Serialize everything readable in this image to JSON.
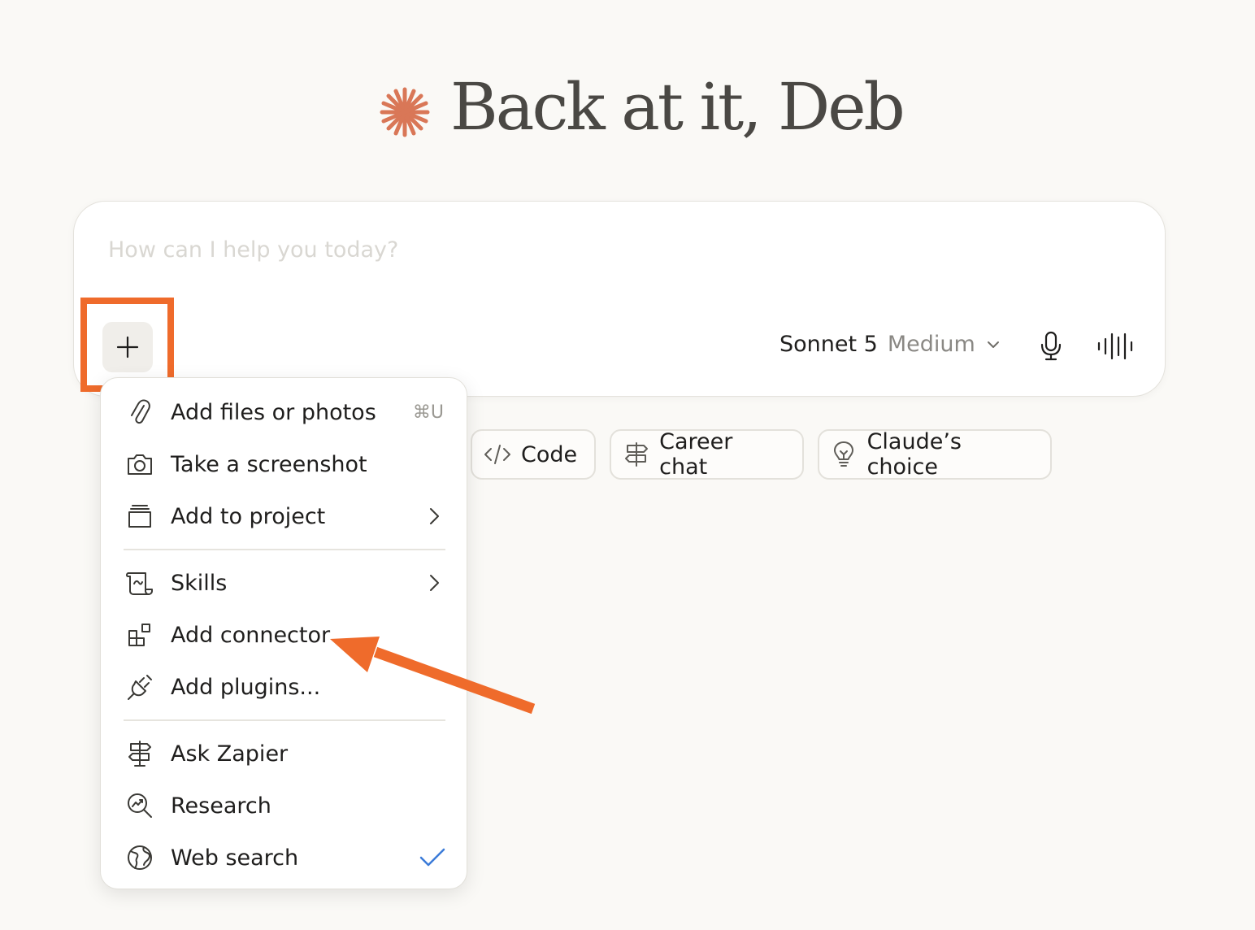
{
  "greeting": {
    "text": "Back at it, Deb"
  },
  "composer": {
    "placeholder": "How can I help you today?",
    "model": {
      "name": "Sonnet 5",
      "effort": "Medium"
    }
  },
  "chips": [
    {
      "label": "Code",
      "icon": "code-icon"
    },
    {
      "label": "Career chat",
      "icon": "signpost-icon"
    },
    {
      "label": "Claude’s choice",
      "icon": "lightbulb-icon"
    }
  ],
  "menu": {
    "items": [
      {
        "label": "Add files or photos",
        "icon": "paperclip-icon",
        "shortcut": "⌘U"
      },
      {
        "label": "Take a screenshot",
        "icon": "camera-icon"
      },
      {
        "label": "Add to project",
        "icon": "project-icon",
        "submenu": true
      },
      {
        "label": "Skills",
        "icon": "scroll-icon",
        "submenu": true
      },
      {
        "label": "Add connector",
        "icon": "connector-icon"
      },
      {
        "label": "Add plugins...",
        "icon": "plug-icon"
      },
      {
        "label": "Ask Zapier",
        "icon": "signpost-icon"
      },
      {
        "label": "Research",
        "icon": "research-icon"
      },
      {
        "label": "Web search",
        "icon": "globe-icon",
        "checked": true
      }
    ]
  },
  "colors": {
    "accent": "#d97757",
    "annotation": "#ef6b2b",
    "check": "#3b7bd8",
    "background": "#faf9f6"
  }
}
